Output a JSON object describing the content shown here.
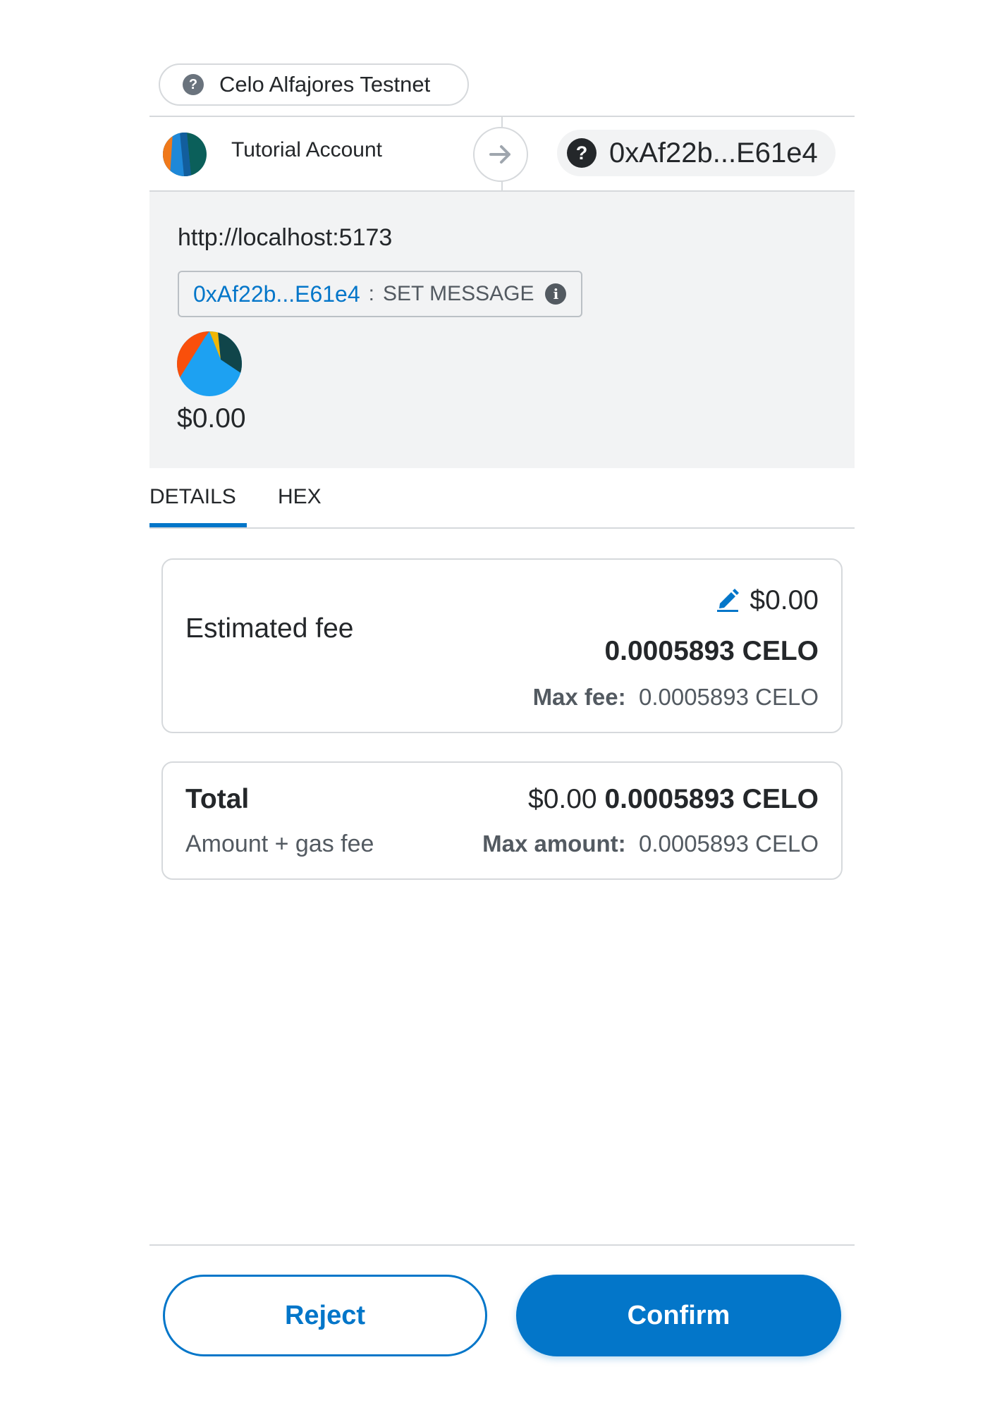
{
  "network": {
    "name": "Celo Alfajores Testnet",
    "icon": "question-mark-icon"
  },
  "accounts": {
    "from_name": "Tutorial Account",
    "to_address": "0xAf22b...E61e4",
    "to_icon": "question-mark-icon",
    "arrow_icon": "arrow-right-icon"
  },
  "request": {
    "origin": "http://localhost:5173",
    "contract_address": "0xAf22b...E61e4",
    "separator": ":",
    "method": "SET MESSAGE",
    "amount": "$0.00"
  },
  "tabs": [
    {
      "label": "DETAILS",
      "active": true
    },
    {
      "label": "HEX",
      "active": false
    }
  ],
  "fee": {
    "label": "Estimated fee",
    "usd": "$0.00",
    "native": "0.0005893 CELO",
    "max_label": "Max fee:",
    "max_value": "0.0005893 CELO",
    "edit_icon": "pencil-edit-icon"
  },
  "total": {
    "label": "Total",
    "sublabel": "Amount + gas fee",
    "usd": "$0.00",
    "native": "0.0005893 CELO",
    "max_label": "Max amount:",
    "max_value": "0.0005893 CELO"
  },
  "footer": {
    "reject_label": "Reject",
    "confirm_label": "Confirm"
  },
  "colors": {
    "primary": "#0376c9",
    "panel_bg": "#f2f3f4",
    "border": "#d6d9dc",
    "text": "#24272a",
    "muted": "#535a61"
  }
}
